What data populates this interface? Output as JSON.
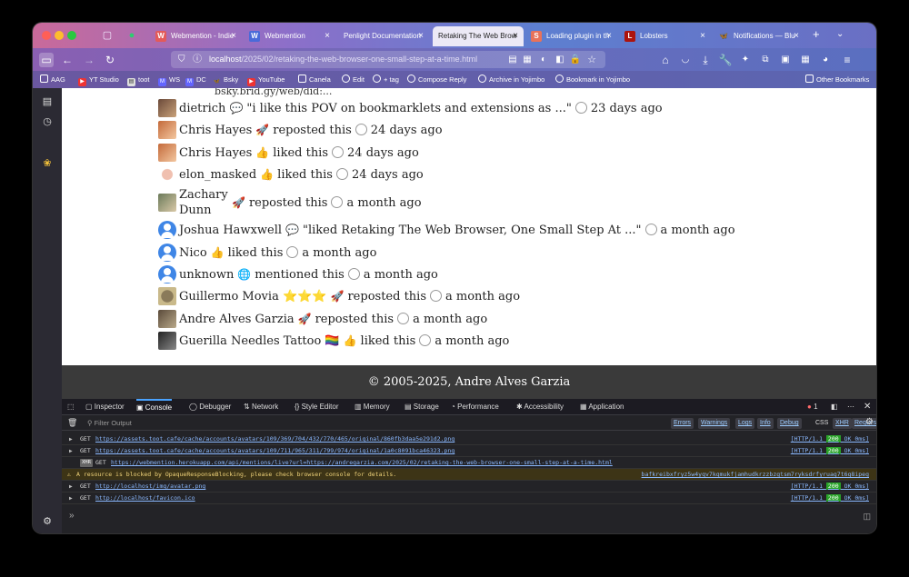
{
  "tabs": [
    {
      "label": "Webmention - Indie",
      "favicon": "W",
      "favicon_color": "#e35a5a"
    },
    {
      "label": "Webmention",
      "favicon": "W",
      "favicon_color": "#4a6ad9"
    },
    {
      "label": "Penlight Documentation",
      "favicon": "",
      "favicon_color": ""
    },
    {
      "label": "Retaking The Web Brow",
      "favicon": "",
      "favicon_color": ""
    },
    {
      "label": "Loading plugin in th",
      "favicon": "S",
      "favicon_color": "#e8725a"
    },
    {
      "label": "Lobsters",
      "favicon": "L",
      "favicon_color": "#ac130d"
    },
    {
      "label": "Notifications — Blu",
      "favicon": "🦋",
      "favicon_color": "#1185fe"
    }
  ],
  "url": {
    "host": "localhost",
    "path": "/2025/02/retaking-the-web-browser-one-small-step-at-a-time.html"
  },
  "bookmarks": [
    {
      "label": "AAG"
    },
    {
      "label": "YT Studio"
    },
    {
      "label": "toot"
    },
    {
      "label": "WS"
    },
    {
      "label": "DC"
    },
    {
      "label": "Bsky"
    },
    {
      "label": "YouTube"
    },
    {
      "label": "Canela"
    },
    {
      "label": "Edit"
    },
    {
      "label": "+ tag"
    },
    {
      "label": "Compose Reply"
    },
    {
      "label": "Archive in Yojimbo"
    },
    {
      "label": "Bookmark in Yojimbo"
    }
  ],
  "other_bookmarks": "Other Bookmarks",
  "page": {
    "truncated_text": "bsky.brid.gy/web/did:...",
    "mentions": [
      {
        "author": "dietrich",
        "emoji": "💬",
        "action": "\"i like this POV on bookmarklets and extensions as ...\"",
        "time": "23 days ago"
      },
      {
        "author": "Chris Hayes",
        "emoji": "🚀",
        "action": "reposted this",
        "time": "24 days ago"
      },
      {
        "author": "Chris Hayes",
        "emoji": "👍",
        "action": "liked this",
        "time": "24 days ago"
      },
      {
        "author": "elon_masked",
        "emoji": "👍",
        "action": "liked this",
        "time": "24 days ago"
      },
      {
        "author": "Zachary Dunn",
        "emoji": "🚀",
        "action": "reposted this",
        "time": "a month ago"
      },
      {
        "author": "Joshua Hawxwell",
        "emoji": "💬",
        "action": "\"liked Retaking The Web Browser, One Small Step At ...\"",
        "time": "a month ago"
      },
      {
        "author": "Nico",
        "emoji": "👍",
        "action": "liked this",
        "time": "a month ago"
      },
      {
        "author": "unknown",
        "emoji": "🌐",
        "action": "mentioned this",
        "time": "a month ago"
      },
      {
        "author": "Guillermo Movia ⭐⭐⭐",
        "emoji": "🚀",
        "action": "reposted this",
        "time": "a month ago"
      },
      {
        "author": "Andre Alves Garzia",
        "emoji": "🚀",
        "action": "reposted this",
        "time": "a month ago"
      },
      {
        "author": "Guerilla Needles Tattoo 🏳️‍🌈",
        "emoji": "👍",
        "action": "liked this",
        "time": "a month ago"
      }
    ],
    "footer": "© 2005-2025, Andre Alves Garzia"
  },
  "devtools": {
    "tabs": [
      "Inspector",
      "Console",
      "Debugger",
      "Network",
      "Style Editor",
      "Memory",
      "Storage",
      "Performance",
      "Accessibility",
      "Application"
    ],
    "error_count": "1",
    "filter_placeholder": "Filter Output",
    "filters": [
      "Errors",
      "Warnings",
      "Logs",
      "Info",
      "Debug"
    ],
    "toggles": [
      "CSS",
      "XHR",
      "Requests"
    ],
    "logs": [
      {
        "type": "get",
        "method": "GET",
        "url": "https://assets.toot.cafe/cache/accounts/avatars/109/369/704/432/770/465/original/860fb3daa5e291d2.png",
        "proto": "[HTTP/1.1",
        "code": "200",
        "status": "OK 0ms]"
      },
      {
        "type": "get",
        "method": "GET",
        "url": "https://assets.toot.cafe/cache/accounts/avatars/109/711/965/311/799/974/original/1a0c8091bca46323.png",
        "proto": "[HTTP/1.1",
        "code": "200",
        "status": "OK 0ms]"
      },
      {
        "type": "xhr",
        "method": "GET",
        "url": "https://webmention.herokuapp.com/api/mentions/live?url=https://andregarzia.com/2025/02/retaking-the-web-browser-one-small-step-at-a-time.html",
        "proto": "",
        "code": "",
        "status": ""
      },
      {
        "type": "warn",
        "method": "",
        "url": "A resource is blocked by OpaqueResponseBlocking, please check browser console for details.",
        "proto": "bafkreibxfryz5w4yqv7kqmukfjamhudkrzzbzgtsm7ryksdrfyruag7t6q8ipeg",
        "code": "",
        "status": ""
      },
      {
        "type": "get",
        "method": "GET",
        "url": "http://localhost/img/avatar.png",
        "proto": "[HTTP/1.1",
        "code": "200",
        "status": "OK 0ms]"
      },
      {
        "type": "get",
        "method": "GET",
        "url": "http://localhost/favicon.ico",
        "proto": "[HTTP/1.1",
        "code": "200",
        "status": "OK 0ms]"
      }
    ]
  },
  "colors": {
    "ok_badge": "#29a329",
    "link": "#8bb9ff",
    "warn_bg": "#3d3416"
  }
}
